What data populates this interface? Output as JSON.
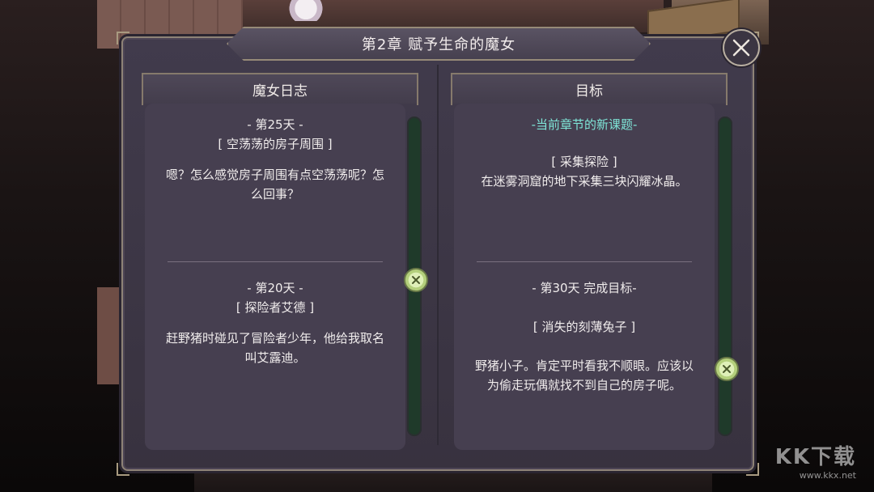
{
  "dialog": {
    "title": "第2章  赋予生命的魔女"
  },
  "left_column": {
    "header": "魔女日志",
    "entries": [
      {
        "day": "- 第25天 -",
        "subtitle": "[ 空荡荡的房子周围 ]",
        "text": "嗯？怎么感觉房子周围有点空荡荡呢？怎么回事？"
      },
      {
        "day": "- 第20天 -",
        "subtitle": "[ 探险者艾德 ]",
        "text": "赶野猪时碰见了冒险者少年，他给我取名叫艾露迪。"
      }
    ]
  },
  "right_column": {
    "header": "目标",
    "current_label": "-当前章节的新课题-",
    "entries": [
      {
        "subtitle": "[ 采集探险 ]",
        "text": "在迷雾洞窟的地下采集三块闪耀冰晶。"
      },
      {
        "day": "- 第30天  完成目标-",
        "subtitle": "[ 消失的刻薄兔子 ]",
        "text": "野猪小子。肯定平时看我不顺眼。应该以为偷走玩偶就找不到自己的房子呢。"
      }
    ]
  },
  "watermark": {
    "logo": "KK下载",
    "url": "www.kkx.net"
  },
  "icons": {
    "close": "close-icon",
    "scroll_knob": "scroll-knob-icon"
  },
  "colors": {
    "accent_text": "#7fe6d8",
    "panel_bg": "#3c3645",
    "scroll_knob": "#c8e08c"
  }
}
